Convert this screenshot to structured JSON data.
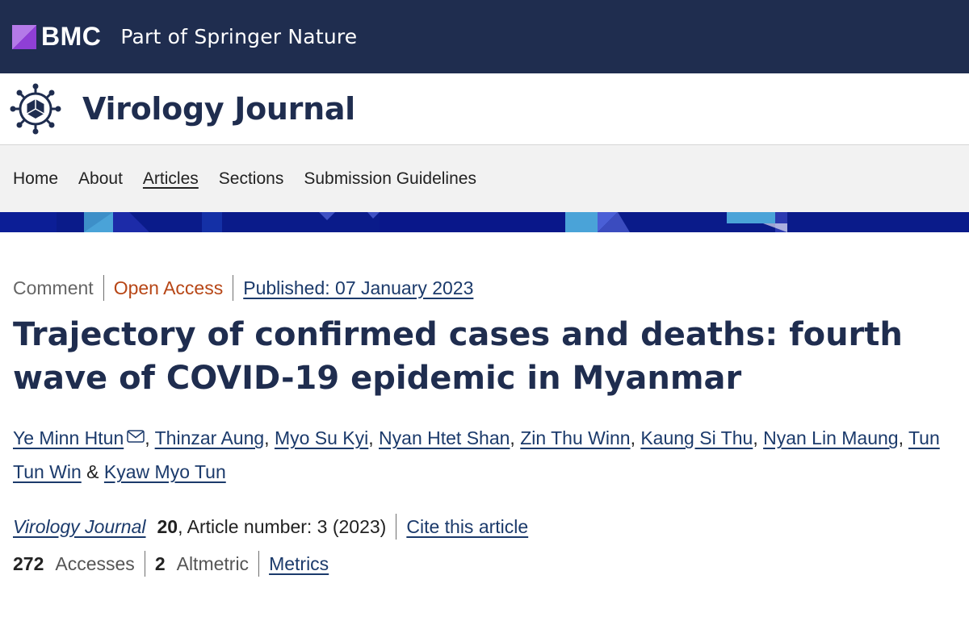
{
  "header": {
    "brand": "BMC",
    "tagline": "Part of Springer Nature",
    "brand_color": "#1f2d4f",
    "brand_mark_color": "#8f3fd6"
  },
  "journal": {
    "title": "Virology Journal",
    "icon": "virus-icon"
  },
  "nav": {
    "items": [
      {
        "label": "Home"
      },
      {
        "label": "About"
      },
      {
        "label": "Articles"
      },
      {
        "label": "Sections"
      },
      {
        "label": "Submission Guidelines"
      }
    ],
    "current": "Articles"
  },
  "article": {
    "type": "Comment",
    "access": "Open Access",
    "published": "Published: 07 January 2023",
    "title": "Trajectory of confirmed cases and deaths: fourth wave of COVID-19 epidemic in Myanmar",
    "authors": [
      {
        "name": "Ye Minn Htun"
      },
      {
        "name": "Thinzar Aung"
      },
      {
        "name": "Myo Su Kyi"
      },
      {
        "name": "Nyan Htet Shan"
      },
      {
        "name": "Zin Thu Winn"
      },
      {
        "name": "Kaung Si Thu"
      },
      {
        "name": "Nyan Lin Maung"
      },
      {
        "name": "Tun Tun Win"
      },
      {
        "name": "Kyaw Myo Tun"
      }
    ],
    "comma": ",",
    "ampersand": "&",
    "journal_name": "Virology Journal",
    "volume": "20",
    "article_number": ", Article number: 3 (2023)",
    "cite_label": "Cite this article",
    "accesses_count": "272",
    "accesses_label": "Accesses",
    "altmetric_count": "2",
    "altmetric_label": "Altmetric",
    "metrics_label": "Metrics",
    "colors": {
      "open_access": "#b74616",
      "link": "#1b3a6b",
      "title": "#1f2d4f"
    }
  }
}
